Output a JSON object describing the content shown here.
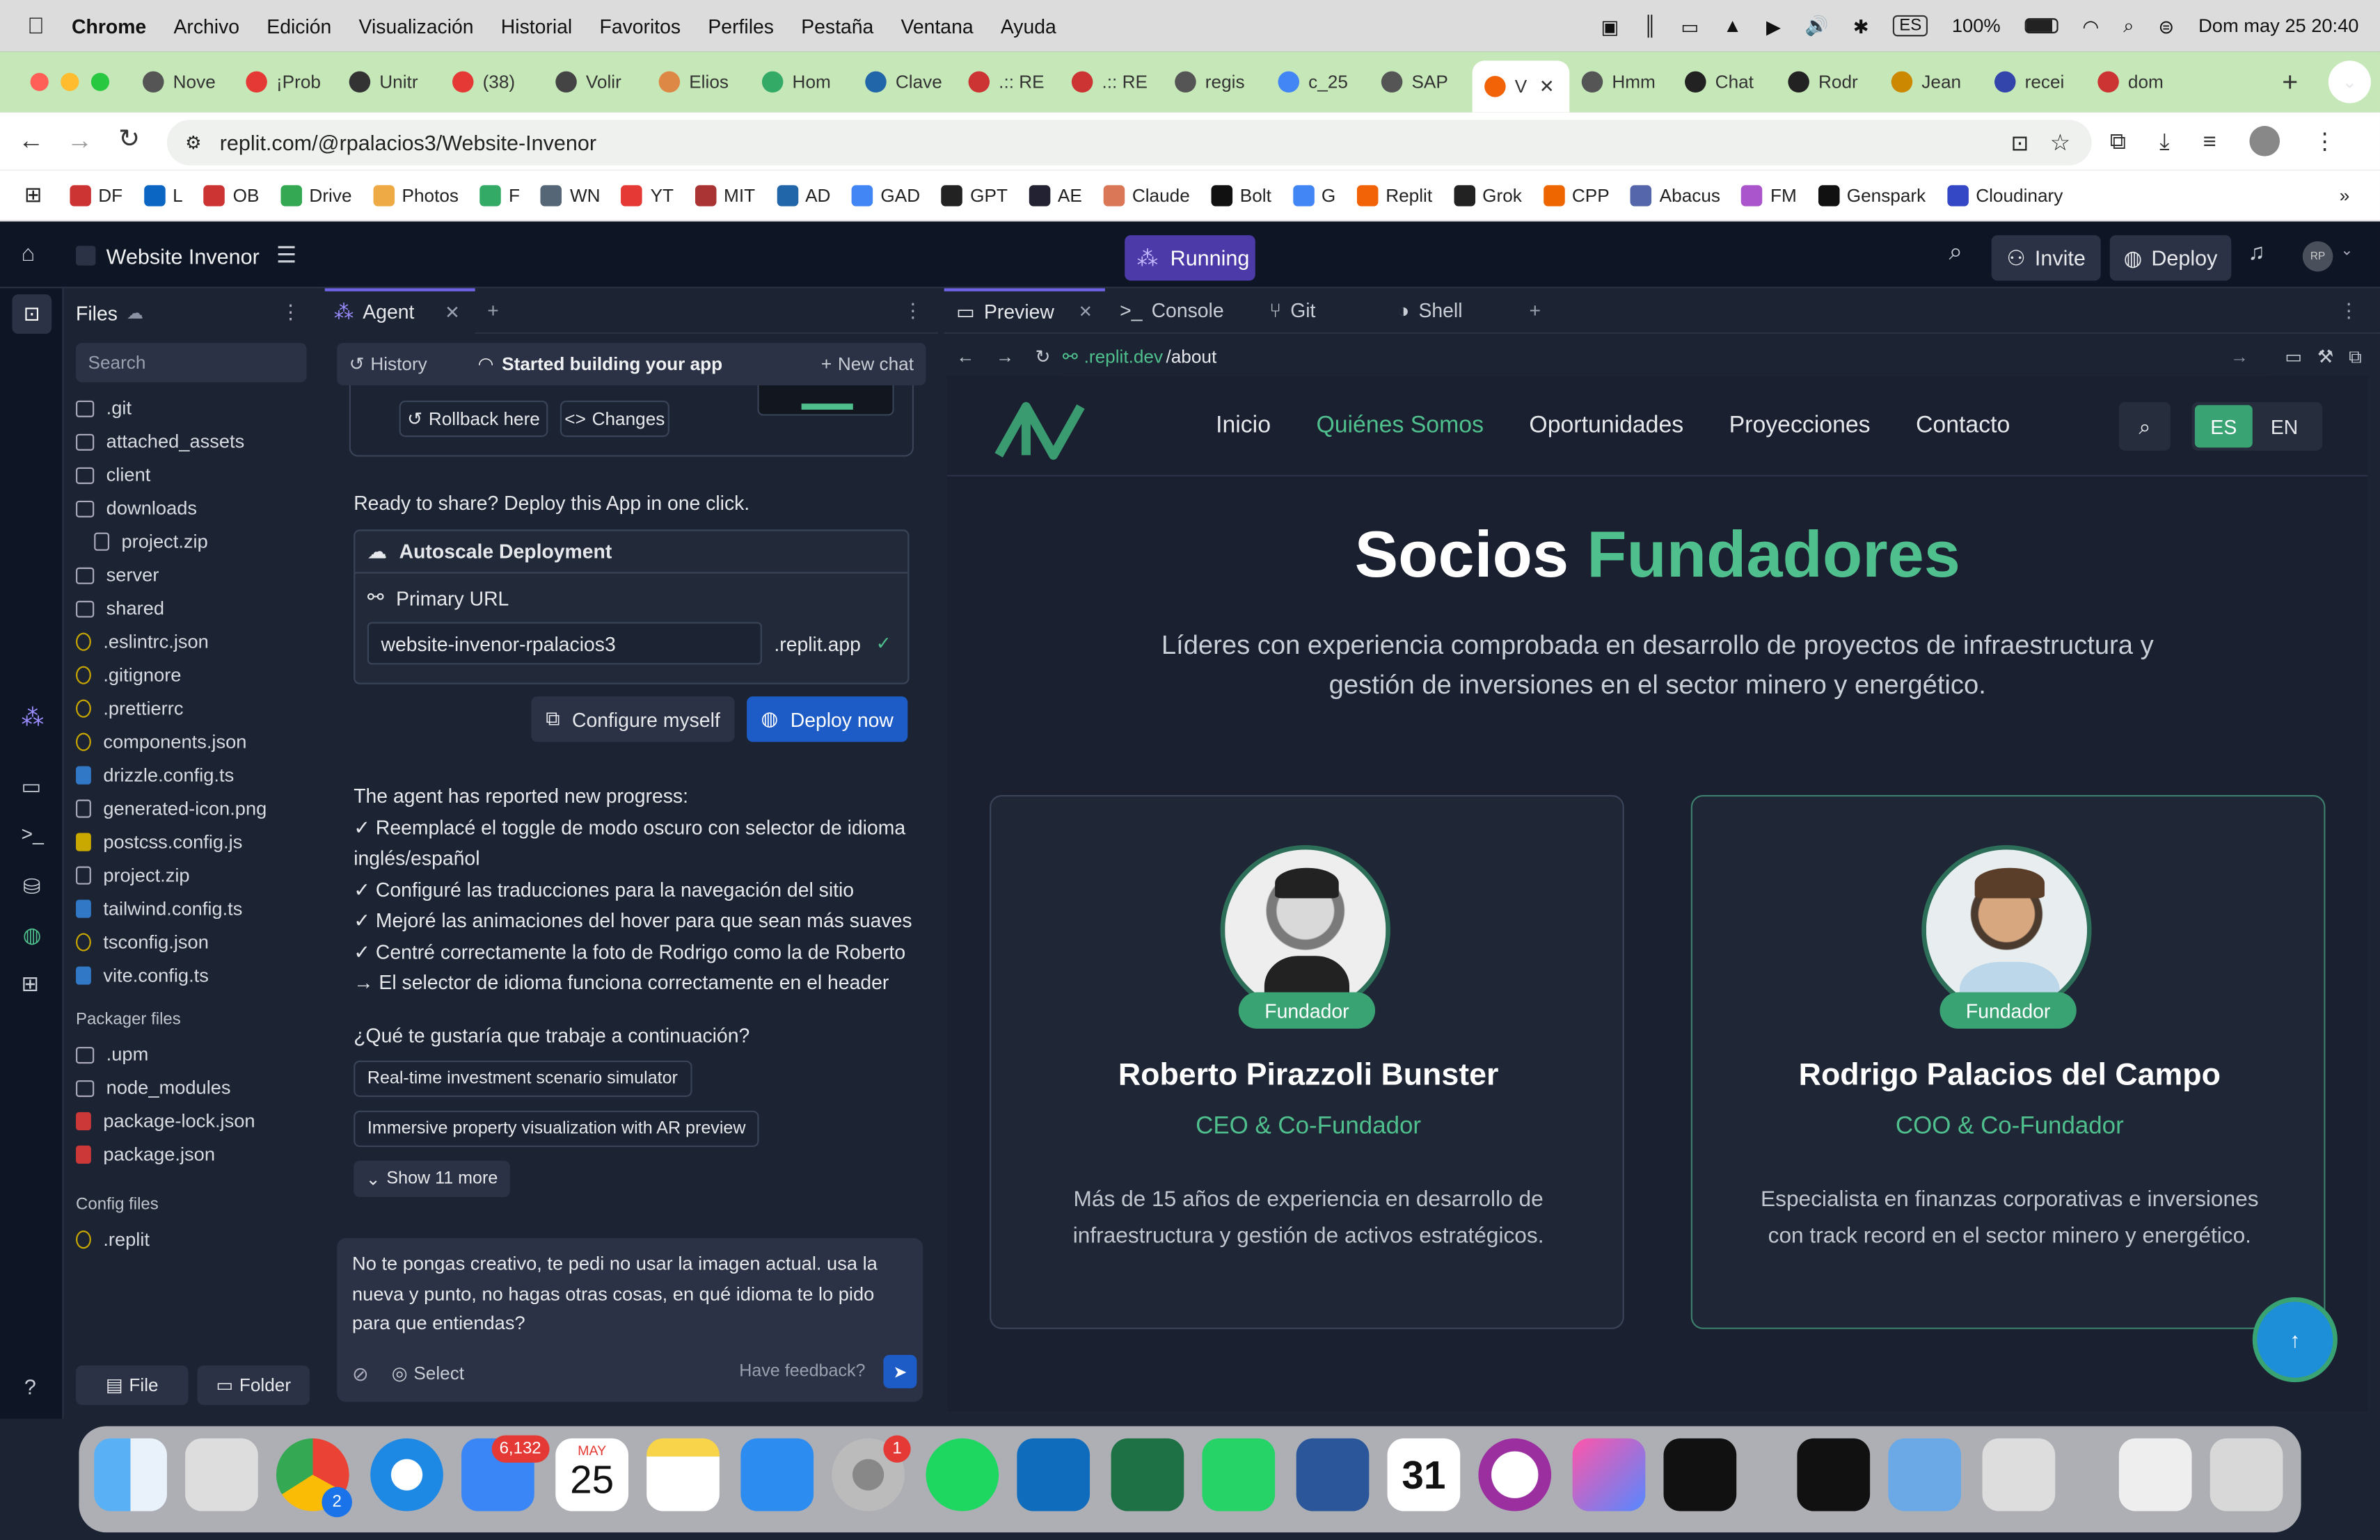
{
  "menubar": {
    "app": "Chrome",
    "items": [
      "Archivo",
      "Edición",
      "Visualización",
      "Historial",
      "Favoritos",
      "Perfiles",
      "Pestaña",
      "Ventana",
      "Ayuda"
    ],
    "lang": "ES",
    "battery": "100%",
    "datetime": "Dom may 25  20:40"
  },
  "chrome": {
    "tabs": [
      {
        "label": "Nove",
        "color": "#555"
      },
      {
        "label": "¡Prob",
        "color": "#e53935"
      },
      {
        "label": "Unitr",
        "color": "#333"
      },
      {
        "label": "(38)",
        "color": "#e53935"
      },
      {
        "label": "Volir",
        "color": "#444"
      },
      {
        "label": "Elios",
        "color": "#d84"
      },
      {
        "label": "Hom",
        "color": "#3a6"
      },
      {
        "label": "Clave",
        "color": "#26a"
      },
      {
        "label": ".:: RE",
        "color": "#c33"
      },
      {
        "label": ".:: RE",
        "color": "#c33"
      },
      {
        "label": "regis",
        "color": "#555"
      },
      {
        "label": "c_25",
        "color": "#4285f4"
      },
      {
        "label": "SAP",
        "color": "#555"
      },
      {
        "label": "V",
        "color": "#f26207"
      },
      {
        "label": "Hmm",
        "color": "#555"
      },
      {
        "label": "Chat",
        "color": "#222"
      },
      {
        "label": "Rodr",
        "color": "#222"
      },
      {
        "label": "Jean",
        "color": "#c80"
      },
      {
        "label": "recei",
        "color": "#34a"
      },
      {
        "label": "dom",
        "color": "#c33"
      }
    ],
    "url": "replit.com/@rpalacios3/Website-Invenor",
    "bookmarks": [
      {
        "label": "DF",
        "color": "#c33"
      },
      {
        "label": "L",
        "color": "#0a66c2"
      },
      {
        "label": "OB",
        "color": "#c33"
      },
      {
        "label": "Drive",
        "color": "#34a853"
      },
      {
        "label": "Photos",
        "color": "#ea4"
      },
      {
        "label": "F",
        "color": "#3a6"
      },
      {
        "label": "WN",
        "color": "#567"
      },
      {
        "label": "YT",
        "color": "#e53935"
      },
      {
        "label": "MIT",
        "color": "#a33"
      },
      {
        "label": "AD",
        "color": "#26a"
      },
      {
        "label": "GAD",
        "color": "#4285f4"
      },
      {
        "label": "GPT",
        "color": "#222"
      },
      {
        "label": "AE",
        "color": "#223"
      },
      {
        "label": "Claude",
        "color": "#d97757"
      },
      {
        "label": "Bolt",
        "color": "#111"
      },
      {
        "label": "G",
        "color": "#4285f4"
      },
      {
        "label": "Replit",
        "color": "#f26207"
      },
      {
        "label": "Grok",
        "color": "#222"
      },
      {
        "label": "CPP",
        "color": "#e60"
      },
      {
        "label": "Abacus",
        "color": "#56a"
      },
      {
        "label": "FM",
        "color": "#a5c"
      },
      {
        "label": "Genspark",
        "color": "#111"
      },
      {
        "label": "Cloudinary",
        "color": "#3448c5"
      }
    ]
  },
  "replit": {
    "project": "Website Invenor",
    "status": "Running",
    "invite": "Invite",
    "deploy": "Deploy",
    "avatar": "RP",
    "files": {
      "title": "Files",
      "search": "Search",
      "items": [
        ".git",
        "attached_assets",
        "client",
        "downloads",
        "project.zip",
        "server",
        "shared",
        ".eslintrc.json",
        ".gitignore",
        ".prettierrc",
        "components.json",
        "drizzle.config.ts",
        "generated-icon.png",
        "postcss.config.js",
        "project.zip",
        "tailwind.config.ts",
        "tsconfig.json",
        "vite.config.ts"
      ],
      "packager_title": "Packager files",
      "packager": [
        ".upm",
        "node_modules",
        "package-lock.json",
        "package.json"
      ],
      "config_title": "Config files",
      "config": [
        ".replit"
      ],
      "new_file": "File",
      "new_folder": "Folder"
    },
    "agent": {
      "tab": "Agent",
      "history": "History",
      "status": "Started building your app",
      "new_chat": "New chat",
      "rollback": "Rollback here",
      "changes": "Changes",
      "share": "Ready to share? Deploy this App in one click.",
      "deploy_title": "Autoscale Deployment",
      "primary_url": "Primary URL",
      "url_value": "website-invenor-rpalacios3",
      "url_suffix": ".replit.app",
      "configure": "Configure myself",
      "deploy_now": "Deploy now",
      "progress_title": "The agent has reported new progress:",
      "progress": [
        "✓ Reemplacé el toggle de modo oscuro con selector de idioma inglés/español",
        "✓ Configuré las traducciones para la navegación del sitio",
        "✓ Mejoré las animaciones del hover para que sean más suaves",
        "✓ Centré correctamente la foto de Rodrigo como la de Roberto",
        "→ El selector de idioma funciona correctamente en el header"
      ],
      "question": "¿Qué te gustaría que trabaje a continuación?",
      "suggestions": [
        "Real-time investment scenario simulator",
        "Immersive property visualization with AR preview"
      ],
      "show_more": "Show 11 more",
      "input": "No te pongas creativo, te pedi no usar la imagen actual. usa la nueva y punto, no hagas otras cosas, en qué idioma te lo pido para que entiendas?",
      "select": "Select",
      "feedback": "Have feedback?"
    },
    "preview_tabs": [
      "Preview",
      "Console",
      "Git",
      "Shell"
    ],
    "preview_url_domain": ".replit.dev",
    "preview_url_path": "/about"
  },
  "site": {
    "nav": [
      "Inicio",
      "Quiénes Somos",
      "Oportunidades",
      "Proyecciones",
      "Contacto"
    ],
    "lang": [
      "ES",
      "EN"
    ],
    "title_a": "Socios",
    "title_b": "Fundadores",
    "subtitle": "Líderes con experiencia comprobada en desarrollo de proyectos de infraestructura y gestión de inversiones en el sector minero y energético.",
    "founders": [
      {
        "badge": "Fundador",
        "name": "Roberto Pirazzoli Bunster",
        "role": "CEO & Co-Fundador",
        "bio": "Más de 15 años de experiencia en desarrollo de infraestructura y gestión de activos estratégicos."
      },
      {
        "badge": "Fundador",
        "name": "Rodrigo Palacios del Campo",
        "role": "COO & Co-Fundador",
        "bio": "Especialista en finanzas corporativas e inversiones con track record en el sector minero y energético."
      }
    ],
    "accent": "#4fc08d"
  },
  "dock": {
    "mail_badge": "6,132",
    "cal_month": "MAY",
    "cal_day": "25",
    "settings_badge": "1",
    "chrome_badge": "2",
    "word_cal": "31"
  }
}
